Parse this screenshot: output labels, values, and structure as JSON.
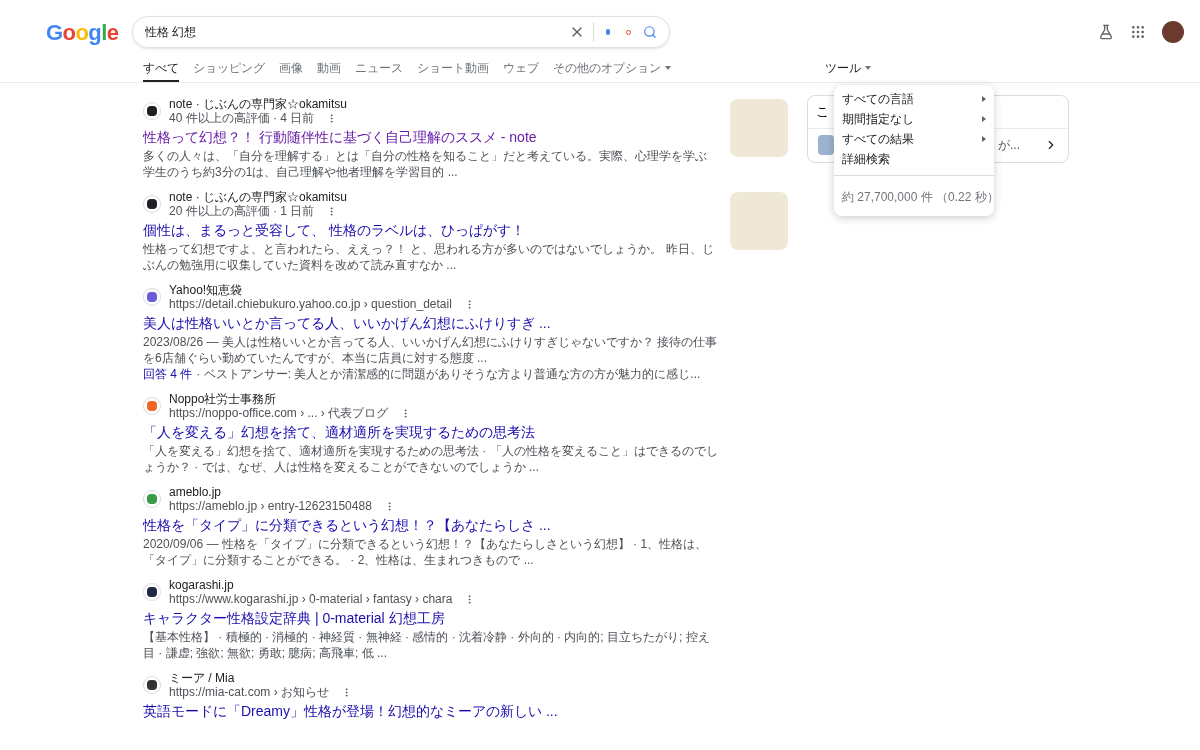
{
  "logo": "Google",
  "search": {
    "value": "性格 幻想"
  },
  "tabs": [
    {
      "label": "すべて",
      "selected": true,
      "dropdown": false
    },
    {
      "label": "ショッピング",
      "selected": false,
      "dropdown": false
    },
    {
      "label": "画像",
      "selected": false,
      "dropdown": false
    },
    {
      "label": "動画",
      "selected": false,
      "dropdown": false
    },
    {
      "label": "ニュース",
      "selected": false,
      "dropdown": false
    },
    {
      "label": "ショート動画",
      "selected": false,
      "dropdown": false
    },
    {
      "label": "ウェブ",
      "selected": false,
      "dropdown": false
    },
    {
      "label": "その他のオプション",
      "selected": false,
      "dropdown": true
    }
  ],
  "tools": {
    "label": "ツール",
    "expanded": true
  },
  "tools_menu": {
    "items": [
      {
        "label": "すべての言語",
        "submenu": true
      },
      {
        "label": "期間指定なし",
        "submenu": true
      },
      {
        "label": "すべての結果",
        "submenu": true
      },
      {
        "label": "詳細検索",
        "submenu": false
      }
    ],
    "result_stats": "約 27,700,000 件 （0.22 秒）"
  },
  "side_card": {
    "title": "こ",
    "snippet": "が..."
  },
  "results": [
    {
      "site": "note · じぶんの専門家☆okamitsu",
      "url": "40 件以上の高評価 · 4 日前",
      "title": "性格って幻想？！ 行動随伴性に基づく自己理解のススメ - note",
      "visited": true,
      "thumbnail": true,
      "snippet": "多くの人々は、「自分を理解する」とは「自分の性格を知ること」だと考えている。実際、心理学を学ぶ学生のうち約3分の1は、自己理解や他者理解を学習目的 ..."
    },
    {
      "site": "note · じぶんの専門家☆okamitsu",
      "url": "20 件以上の高評価 · 1 日前",
      "title": "個性は、まるっと受容して、 性格のラベルは、ひっぱがす！",
      "visited": false,
      "thumbnail": true,
      "snippet": "性格って幻想ですよ、と言われたら、ええっ？！ と、思われる方が多いのではないでしょうか。 昨日、じぶんの勉強用に収集していた資料を改めて読み直すなか ..."
    },
    {
      "site": "Yahoo!知恵袋",
      "url": "https://detail.chiebukuro.yahoo.co.jp › question_detail",
      "title": "美人は性格いいとか言ってる人、いいかげん幻想にふけりすぎ ...",
      "visited": false,
      "thumbnail": false,
      "snippet": "2023/08/26 — 美人は性格いいとか言ってる人、いいかげん幻想にふけりすぎじゃないですか？ 接待の仕事を6店舗ぐらい勤めていたんですが、本当に店員に対する態度 ...",
      "answers": {
        "link": "回答 4 件",
        "text": "· ベストアンサー: 美人とか清潔感的に問題がありそうな方より普通な方の方が魅力的に感じ..."
      }
    },
    {
      "site": "Noppo社労士事務所",
      "url": "https://noppo-office.com › ... › 代表ブログ",
      "title": "「人を変える」幻想を捨て、適材適所を実現するための思考法",
      "visited": false,
      "thumbnail": false,
      "snippet": "「人を変える」幻想を捨て、適材適所を実現するための思考法 · 「人の性格を変えること」はできるのでしょうか？ · では、なぜ、人は性格を変えることができないのでしょうか ..."
    },
    {
      "site": "ameblo.jp",
      "url": "https://ameblo.jp › entry-12623150488",
      "title": "性格を「タイプ」に分類できるという幻想！？【あなたらしさ ...",
      "visited": false,
      "thumbnail": false,
      "snippet": "2020/09/06 — 性格を「タイプ」に分類できるという幻想！？【あなたらしさという幻想】 · 1、性格は、「タイプ」に分類することができる。 · 2、性格は、生まれつきもので ..."
    },
    {
      "site": "kogarashi.jp",
      "url": "https://www.kogarashi.jp › 0-material › fantasy › chara",
      "title": "キャラクター性格設定辞典 | 0-material 幻想工房",
      "visited": false,
      "thumbnail": false,
      "snippet": "【基本性格】 · 積極的 · 消極的 · 神経質 · 無神経 · 感情的 · 沈着冷静 · 外向的 · 内向的; 目立ちたがり; 控え目 · 謙虚; 強欲; 無欲; 勇敢; 臆病; 高飛車; 低 ..."
    },
    {
      "site": "ミーア / Mia",
      "url": "https://mia-cat.com › お知らせ",
      "title": "英語モードに「Dreamy」性格が登場！幻想的なミーアの新しい ...",
      "visited": false,
      "thumbnail": false
    }
  ]
}
